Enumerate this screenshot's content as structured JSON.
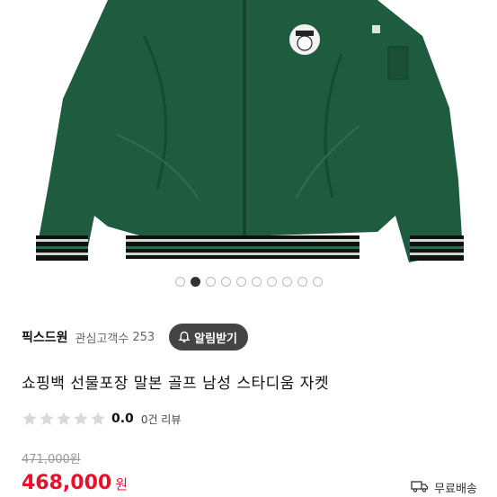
{
  "carousel": {
    "total": 10,
    "active_index": 1
  },
  "seller": {
    "name": "픽스드원",
    "interest_label": "관심고객수",
    "interest_count": "253",
    "alarm_label": "알림받기"
  },
  "product": {
    "title": "쇼핑백 선물포장 말본 골프 남성 스타디움 자켓"
  },
  "rating": {
    "score": "0.0",
    "reviews": "0건 리뷰",
    "stars_filled": 0,
    "stars_total": 5
  },
  "price": {
    "original": "471,000원",
    "sale": "468,000",
    "unit": "원"
  },
  "shipping": {
    "label": "무료배송",
    "icon": "truck-icon"
  },
  "colors": {
    "jacket_green": "#1f5c3f",
    "sale_red": "#e8102a",
    "button_dark": "#444444"
  }
}
